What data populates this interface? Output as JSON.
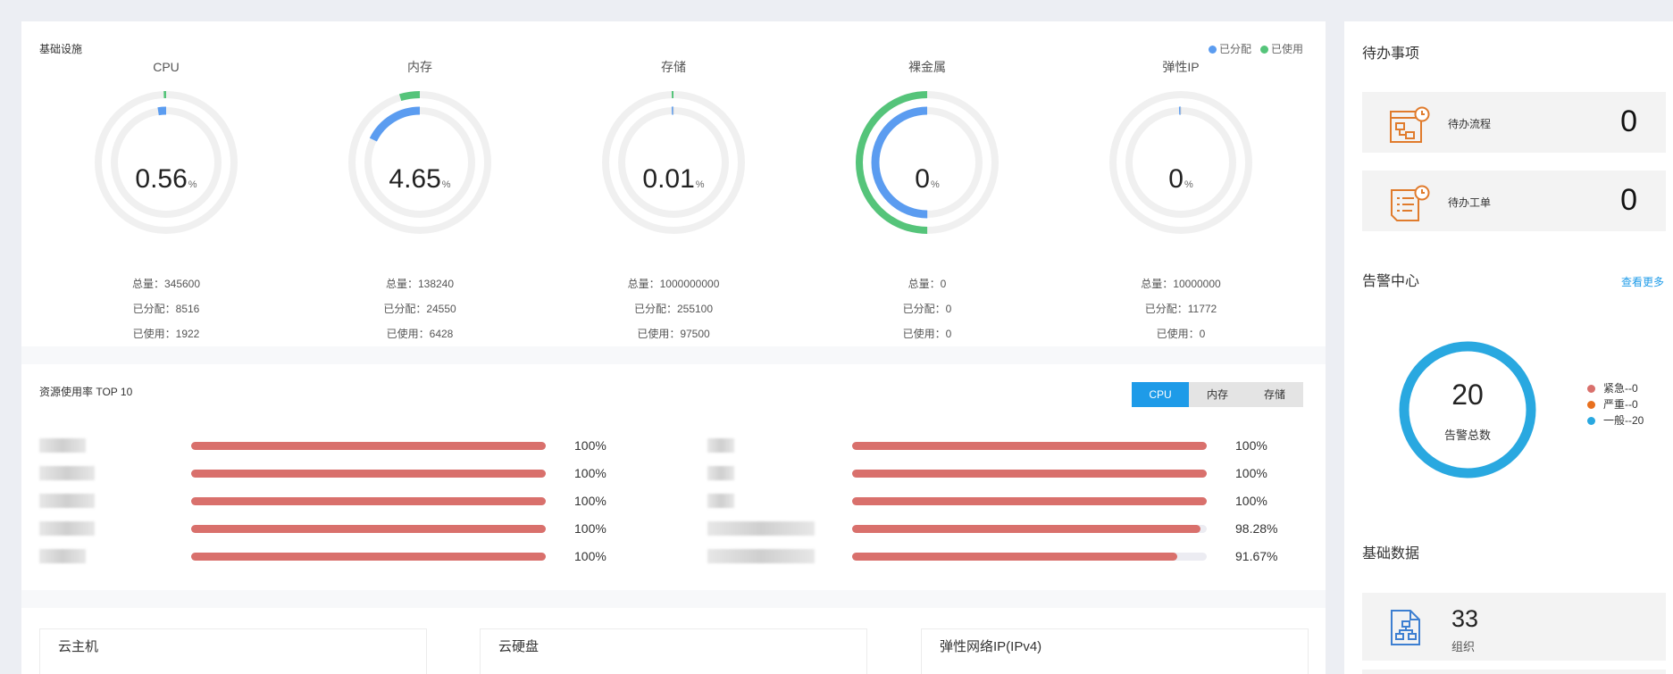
{
  "infra": {
    "title": "基础设施",
    "legend": {
      "allocated": "已分配",
      "used": "已使用",
      "allocated_color": "#5b9cf0",
      "used_color": "#55c47a"
    },
    "gauges": [
      {
        "name": "CPU",
        "value": "0.56",
        "unit": "%",
        "allocated_pct": 0.0246,
        "used_pct": 0.0056,
        "total": "总量：345600",
        "allocated": "已分配：8516",
        "used": "已使用：1922"
      },
      {
        "name": "内存",
        "value": "4.65",
        "unit": "%",
        "allocated_pct": 0.1776,
        "used_pct": 0.0465,
        "total": "总量：138240",
        "allocated": "已分配：24550",
        "used": "已使用：6428"
      },
      {
        "name": "存储",
        "value": "0.01",
        "unit": "%",
        "allocated_pct": 0.000255,
        "used_pct": 9.75e-05,
        "total": "总量：1000000000",
        "allocated": "已分配：255100",
        "used": "已使用：97500"
      },
      {
        "name": "裸金属",
        "value": "0",
        "unit": "%",
        "allocated_pct": 0.5,
        "used_pct": 0.5,
        "total": "总量：0",
        "allocated": "已分配：0",
        "used": "已使用：0"
      },
      {
        "name": "弹性IP",
        "value": "0",
        "unit": "%",
        "allocated_pct": 0.0012,
        "used_pct": 0,
        "total": "总量：10000000",
        "allocated": "已分配：11772",
        "used": "已使用：0"
      }
    ]
  },
  "top10": {
    "title": "资源使用率 TOP 10",
    "tabs": [
      "CPU",
      "内存",
      "存储"
    ],
    "active_tab": 0,
    "left": [
      {
        "pct_label": "100%",
        "value": 1.0
      },
      {
        "pct_label": "100%",
        "value": 1.0
      },
      {
        "pct_label": "100%",
        "value": 1.0
      },
      {
        "pct_label": "100%",
        "value": 1.0
      },
      {
        "pct_label": "100%",
        "value": 1.0
      }
    ],
    "right": [
      {
        "pct_label": "100%",
        "value": 1.0
      },
      {
        "pct_label": "100%",
        "value": 1.0
      },
      {
        "pct_label": "100%",
        "value": 1.0
      },
      {
        "pct_label": "98.28%",
        "value": 0.9828
      },
      {
        "pct_label": "91.67%",
        "value": 0.9167
      }
    ]
  },
  "resources": [
    "云主机",
    "云硬盘",
    "弹性网络IP(IPv4)"
  ],
  "todo": {
    "title": "待办事项",
    "items": [
      {
        "label": "待办流程",
        "count": "0",
        "icon": "workflow-icon"
      },
      {
        "label": "待办工单",
        "count": "0",
        "icon": "work-order-icon"
      }
    ]
  },
  "alarm": {
    "title": "告警中心",
    "more": "查看更多",
    "total": "20",
    "total_label": "告警总数",
    "ring_color": "#29a8e0",
    "levels": [
      {
        "label": "紧急--0",
        "color": "#d9706c"
      },
      {
        "label": "严重--0",
        "color": "#e8701e"
      },
      {
        "label": "一般--20",
        "color": "#29a8e0"
      }
    ]
  },
  "base_data": {
    "title": "基础数据",
    "items": [
      {
        "count": "33",
        "label": "组织",
        "icon": "organization-icon"
      }
    ]
  }
}
